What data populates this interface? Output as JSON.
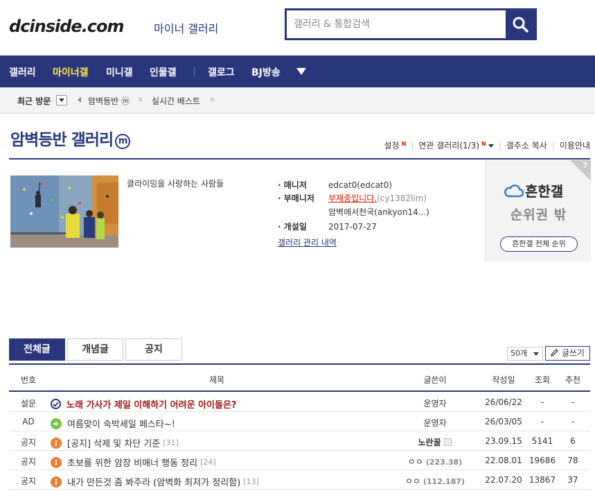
{
  "header": {
    "logo": "dcinside.com",
    "logo_sub": "마이너 갤러리",
    "search_placeholder": "갤러리 & 통합검색"
  },
  "nav": {
    "items": [
      {
        "label": "갤러리"
      },
      {
        "label": "마이너갤"
      },
      {
        "label": "미니갤"
      },
      {
        "label": "인물갤"
      },
      {
        "label": "갤로그"
      },
      {
        "label": "BJ방송"
      }
    ],
    "active_index": 1
  },
  "recent": {
    "label": "최근 방문",
    "items": [
      {
        "label": "암벽등반 ⓜ"
      },
      {
        "label": "실시간 베스트"
      }
    ]
  },
  "gallery": {
    "title": "암벽등반 갤러리",
    "badge": "m",
    "links": {
      "settings": "설정",
      "related": "연관 갤러리(1/3)",
      "copy_address": "갤주소 복사",
      "usage": "이용안내"
    },
    "new_mark": "N",
    "description": "클라이밍을 사랑하는 사람들",
    "info": {
      "manager_label": "매니저",
      "manager_value": "edcat0(edcat0)",
      "submanager_label": "부매니저",
      "submanager_vacant": "부재중입니다.",
      "submanager_id": "(cy1382lim)",
      "submanager_2": "암벽에서천국(ankyon14...)",
      "founded_label": "개설일",
      "founded_value": "2017-07-27",
      "history_link": "갤러리 관리 내역"
    },
    "bullet": "·"
  },
  "rank_box": {
    "q": "?",
    "brand": "흔한갤",
    "status": "순위권 밖",
    "button": "흔한갤 전체 순위"
  },
  "tabs": [
    {
      "label": "전체글"
    },
    {
      "label": "개념글"
    },
    {
      "label": "공지"
    }
  ],
  "list_controls": {
    "per_page": "50개",
    "write": "글쓰기"
  },
  "table": {
    "headers": {
      "num": "번호",
      "title": "제목",
      "writer": "글쓴이",
      "date": "작성일",
      "views": "조회",
      "rec": "추천"
    },
    "rows": [
      {
        "num": "설문",
        "icon": "poll-icon",
        "title": "노래 가사가 제일 이해하기 어려운 아이돌은?",
        "count": "",
        "writer": "운영자",
        "ip": "",
        "date": "26/06/22",
        "views": "-",
        "rec": "-"
      },
      {
        "num": "AD",
        "icon": "speaker-icon",
        "title": "여름맞이 숙박세일 페스타~!",
        "count": "",
        "writer": "운영자",
        "ip": "",
        "date": "26/03/05",
        "views": "-",
        "rec": "-"
      },
      {
        "num": "공지",
        "icon": "notice-icon",
        "title": "[공지] 삭제 및 차단 기준",
        "count": "[31]",
        "writer": "노란꿀",
        "ip": "",
        "date": "23.09.15",
        "views": "5141",
        "rec": "6"
      },
      {
        "num": "공지",
        "icon": "notice-icon",
        "title": "초보를 위한 암장 비매너 행동 정리",
        "count": "[24]",
        "writer": "ㅇㅇ",
        "ip": "(223.38)",
        "date": "22.08.01",
        "views": "19686",
        "rec": "78"
      },
      {
        "num": "공지",
        "icon": "notice-icon",
        "title": "내가 만든것 좀 봐주라 (암벽화 최저가 정리함)",
        "count": "[13]",
        "writer": "ㅇㅇ",
        "ip": "(112.187)",
        "date": "22.07.20",
        "views": "13867",
        "rec": "37"
      }
    ]
  },
  "colors": {
    "brand": "#29367c",
    "active_nav": "#ffe84a",
    "alert_red": "#d31900",
    "notice_orange": "#f07f32",
    "ad_green": "#7ac143"
  }
}
